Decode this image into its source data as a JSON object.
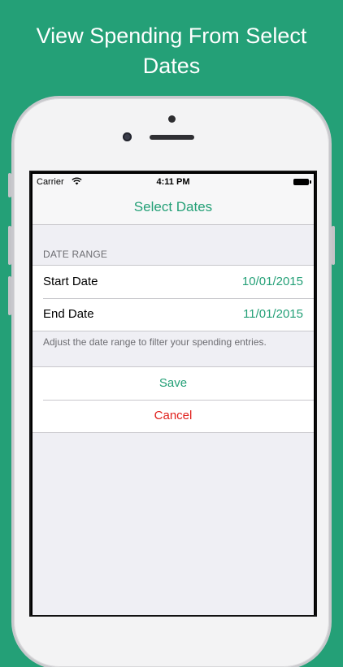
{
  "headline": {
    "line1": "View Spending From Select",
    "line2": "Dates"
  },
  "status_bar": {
    "carrier": "Carrier",
    "time": "4:11 PM",
    "wifi_icon": "wifi-icon",
    "battery_icon": "battery-icon"
  },
  "nav": {
    "title": "Select Dates"
  },
  "date_range": {
    "header": "DATE RANGE",
    "start_label": "Start Date",
    "start_value": "10/01/2015",
    "end_label": "End Date",
    "end_value": "11/01/2015",
    "footnote": "Adjust the date range to filter your spending entries."
  },
  "actions": {
    "save_label": "Save",
    "cancel_label": "Cancel"
  },
  "colors": {
    "background": "#24a077",
    "accent": "#24a077",
    "destructive": "#e0201c",
    "grouped_background": "#efeff4"
  }
}
